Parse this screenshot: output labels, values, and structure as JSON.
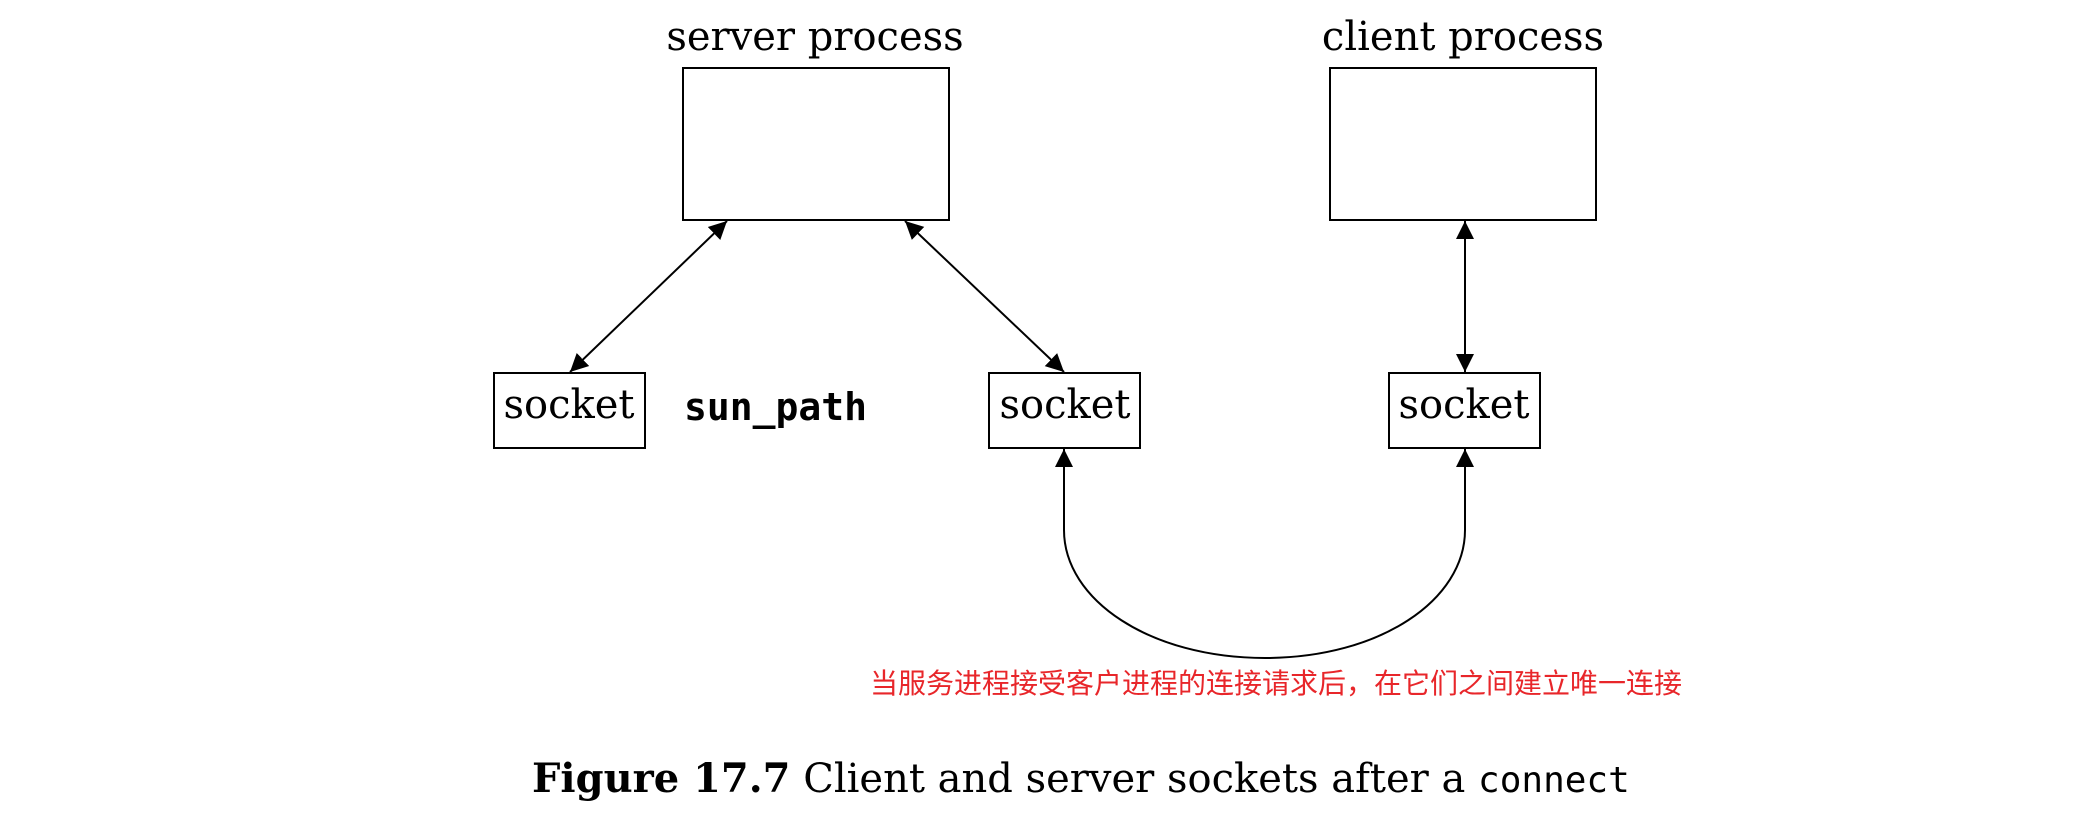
{
  "diagram": {
    "server_process_label": "server process",
    "client_process_label": "client process",
    "server_socket_left_label": "socket",
    "server_socket_right_label": "socket",
    "client_socket_label": "socket",
    "sun_path_label": "sun_path",
    "annotation": "当服务进程接受客户进程的连接请求后，在它们之间建立唯一连接",
    "annotation_color": "#e8262a"
  },
  "caption": {
    "figure_number": "Figure 17.7",
    "text": "Client and server sockets after a ",
    "code": "connect"
  }
}
